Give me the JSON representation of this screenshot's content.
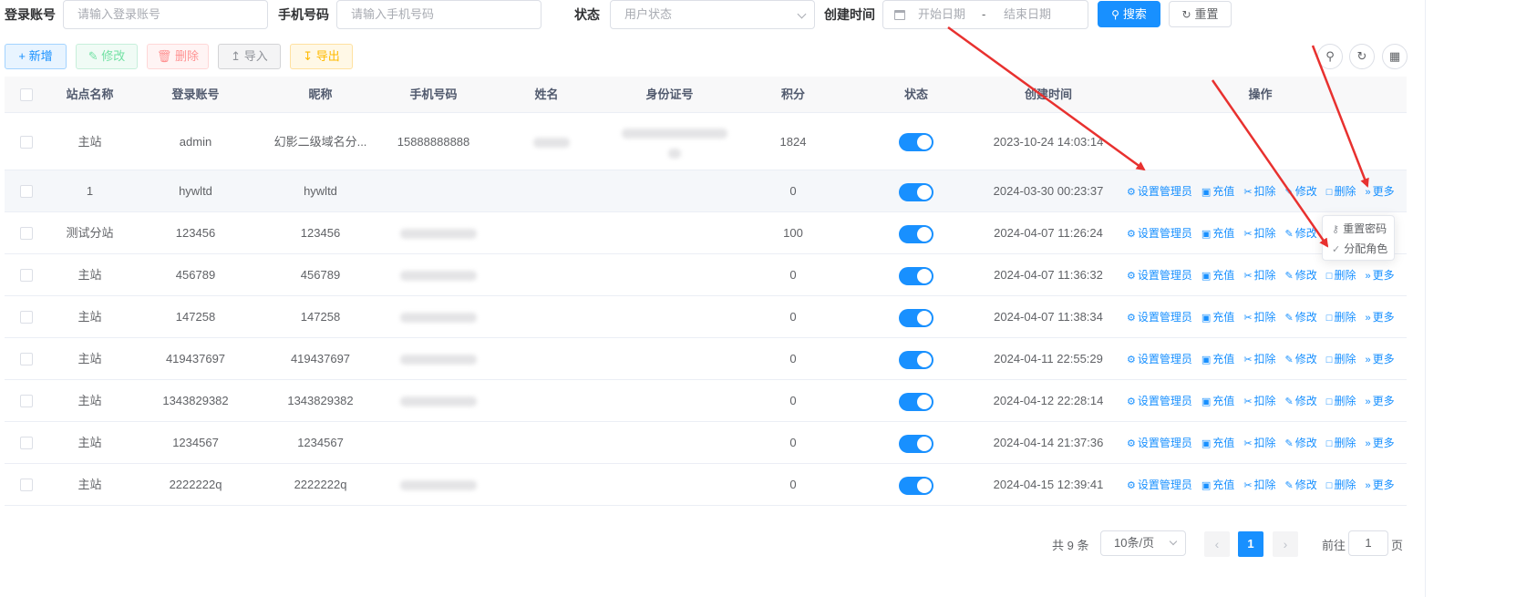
{
  "search": {
    "login_label": "登录账号",
    "login_placeholder": "请输入登录账号",
    "phone_label": "手机号码",
    "phone_placeholder": "请输入手机号码",
    "status_label": "状态",
    "status_placeholder": "用户状态",
    "created_label": "创建时间",
    "start_placeholder": "开始日期",
    "range_sep": "-",
    "end_placeholder": "结束日期",
    "search_button": "搜索",
    "reset_button": "重置"
  },
  "toolbar": {
    "add": "新增",
    "edit": "修改",
    "delete": "删除",
    "import": "导入",
    "export": "导出"
  },
  "table": {
    "headers": [
      "站点名称",
      "登录账号",
      "昵称",
      "手机号码",
      "姓名",
      "身份证号",
      "积分",
      "状态",
      "创建时间",
      "操作"
    ],
    "rows": [
      {
        "site": "主站",
        "account": "admin",
        "nickname": "幻影二级域名分...",
        "phone": "15888888888",
        "name": "",
        "idcard": "",
        "points": "1824",
        "created": "2023-10-24 14:03:14"
      },
      {
        "site": "1",
        "account": "hywltd",
        "nickname": "hywltd",
        "phone": "",
        "name": "",
        "idcard": "",
        "points": "0",
        "created": "2024-03-30 00:23:37"
      },
      {
        "site": "测试分站",
        "account": "123456",
        "nickname": "123456",
        "phone": "",
        "name": "",
        "idcard": "",
        "points": "100",
        "created": "2024-04-07 11:26:24"
      },
      {
        "site": "主站",
        "account": "456789",
        "nickname": "456789",
        "phone": "",
        "name": "",
        "idcard": "",
        "points": "0",
        "created": "2024-04-07 11:36:32"
      },
      {
        "site": "主站",
        "account": "147258",
        "nickname": "147258",
        "phone": "",
        "name": "",
        "idcard": "",
        "points": "0",
        "created": "2024-04-07 11:38:34"
      },
      {
        "site": "主站",
        "account": "419437697",
        "nickname": "419437697",
        "phone": "",
        "name": "",
        "idcard": "",
        "points": "0",
        "created": "2024-04-11 22:55:29"
      },
      {
        "site": "主站",
        "account": "1343829382",
        "nickname": "1343829382",
        "phone": "",
        "name": "",
        "idcard": "",
        "points": "0",
        "created": "2024-04-12 22:28:14"
      },
      {
        "site": "主站",
        "account": "1234567",
        "nickname": "1234567",
        "phone": "",
        "name": "",
        "idcard": "",
        "points": "0",
        "created": "2024-04-14 21:37:36"
      },
      {
        "site": "主站",
        "account": "2222222q",
        "nickname": "2222222q",
        "phone": "",
        "name": "",
        "idcard": "",
        "points": "0",
        "created": "2024-04-15 12:39:41"
      }
    ],
    "actions": {
      "set_admin": "设置管理员",
      "recharge": "充值",
      "deduct": "扣除",
      "edit": "修改",
      "delete": "删除",
      "more": "更多"
    }
  },
  "dropdown": {
    "reset_password": "重置密码",
    "assign_role": "分配角色"
  },
  "pagination": {
    "total": "共 9 条",
    "page_size": "10条/页",
    "prev": "‹",
    "current": "1",
    "next": "›",
    "goto_label": "前往",
    "goto_value": "1",
    "goto_suffix": "页"
  },
  "colors": {
    "primary": "#1890ff",
    "annotation": "#e8312f"
  }
}
